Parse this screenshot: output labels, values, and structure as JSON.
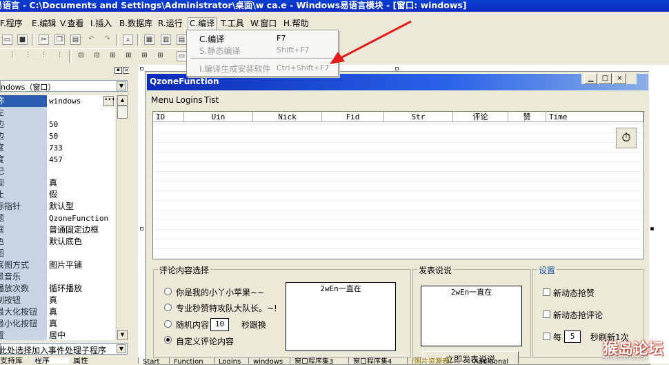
{
  "window": {
    "title": "易语言 - C:\\Documents and Settings\\Administrator\\桌面\\w ca.e - Windows易语言模块 - [窗口: windows]"
  },
  "menu": [
    {
      "label": "F.程序"
    },
    {
      "label": "E.编辑"
    },
    {
      "label": "V.查看"
    },
    {
      "label": "I.插入"
    },
    {
      "label": "B.数据库"
    },
    {
      "label": "R.运行"
    },
    {
      "label": "C.编译"
    },
    {
      "label": "T.工具"
    },
    {
      "label": "W.窗口"
    },
    {
      "label": "H.帮助"
    }
  ],
  "compile_menu": {
    "items": [
      {
        "label": "C.编译",
        "shortcut": "F7",
        "enabled": true
      },
      {
        "label": "S.静态编译",
        "shortcut": "Shift+F7",
        "enabled": false
      },
      {
        "label": "I.编译生成安装软件",
        "shortcut": "Ctrl+Shift+F7",
        "enabled": false
      }
    ]
  },
  "panel": {
    "selector": "ndows（窗口）",
    "properties": [
      {
        "key": "称",
        "value": "windows"
      },
      {
        "key": "左",
        "value": ""
      },
      {
        "key": "边",
        "value": "50"
      },
      {
        "key": "边",
        "value": "50"
      },
      {
        "key": "度",
        "value": "733"
      },
      {
        "key": "度",
        "value": "457"
      },
      {
        "key": "记",
        "value": ""
      },
      {
        "key": "视",
        "value": "真"
      },
      {
        "key": "止",
        "value": "假"
      },
      {
        "key": "标指针",
        "value": "默认型"
      },
      {
        "key": "题",
        "value": "QzoneFunction"
      },
      {
        "key": "框",
        "value": "普通固定边框"
      },
      {
        "key": "色",
        "value": "默认底色"
      },
      {
        "key": "图",
        "value": ""
      },
      {
        "key": "底图方式",
        "value": "图片平铺"
      },
      {
        "key": "景音乐",
        "value": ""
      },
      {
        "key": "播放次数",
        "value": "循环播放"
      },
      {
        "key": "制按钮",
        "value": "真"
      },
      {
        "key": "最大化按钮",
        "value": "真"
      },
      {
        "key": "最小化按钮",
        "value": "真"
      },
      {
        "key": "置",
        "value": "居中"
      }
    ],
    "event_select": "此处选择加入事件处理子程序",
    "tabs": [
      "支持库",
      "程序",
      "属性"
    ]
  },
  "form": {
    "title": "QzoneFunction",
    "menu": [
      "Menu",
      "Logins",
      "Tist"
    ],
    "columns": [
      "ID",
      "Uin",
      "Nick",
      "Fid",
      "Str",
      "评论",
      "赞",
      "Time"
    ],
    "comment_group": {
      "title": "评论内容选择",
      "options": [
        {
          "label": "你是我的小丫小苹果~~",
          "selected": false
        },
        {
          "label": "专业秒赞特攻队大队长。~!",
          "selected": false
        },
        {
          "label": "随机内容",
          "selected": false
        },
        {
          "label": "自定义评论内容",
          "selected": true
        }
      ],
      "random_count": "10",
      "random_suffix": "秒跟换",
      "textbox": "2wEn一直在"
    },
    "post_group": {
      "title": "发表说说",
      "textbox": "2wEn一直在",
      "button": "立即发表说说"
    },
    "settings_group": {
      "title": "设置",
      "checks": [
        {
          "label": "新动态抢赞",
          "checked": false
        },
        {
          "label": "新动态抢评论",
          "checked": false
        }
      ],
      "refresh_prefix": "每",
      "refresh_value": "5",
      "refresh_suffix": "秒刷新1次"
    }
  },
  "bottom_tabs": [
    "Start",
    "Function",
    "Logins",
    "windows",
    "窗口程序集3",
    "窗口程序集4",
    "[图片资源表]",
    "Additional"
  ],
  "watermark": {
    "text": "猴岛论坛",
    "sub": "BBS.HOUDAO.COM"
  },
  "colors": {
    "title_blue": "#0b34c8",
    "arrow_red": "#e21b1b",
    "header_key_bg": "#c8d4e6"
  }
}
